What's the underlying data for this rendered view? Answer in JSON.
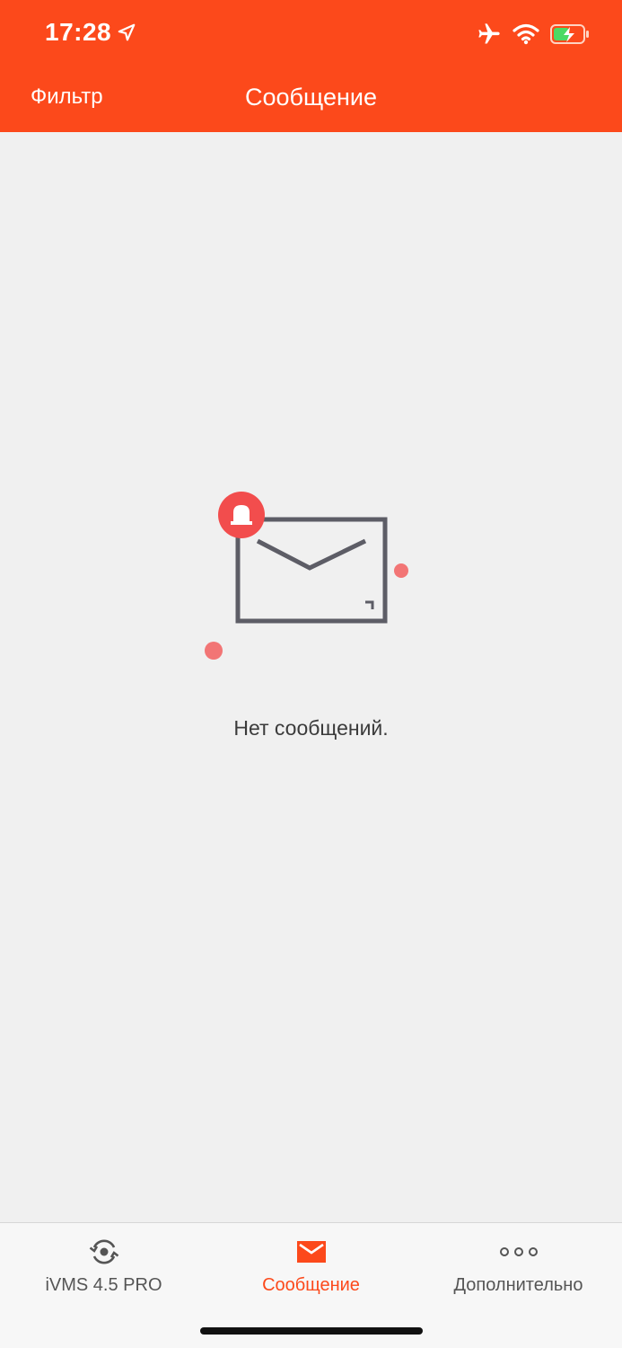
{
  "status_bar": {
    "time": "17:28",
    "icons": [
      "location-arrow-icon",
      "airplane-icon",
      "wifi-icon",
      "battery-charging-icon"
    ]
  },
  "nav_bar": {
    "filter_label": "Фильтр",
    "title": "Сообщение",
    "background": "#fc491b"
  },
  "empty_state": {
    "message": "Нет сообщений.",
    "icon": "envelope-alarm-icon"
  },
  "tab_bar": {
    "tabs": [
      {
        "label": "iVMS 4.5 PRO",
        "icon": "camera-target-icon",
        "active": false
      },
      {
        "label": "Сообщение",
        "icon": "envelope-icon",
        "active": true
      },
      {
        "label": "Дополнительно",
        "icon": "more-dots-icon",
        "active": false
      }
    ],
    "active_color": "#fc491b"
  }
}
